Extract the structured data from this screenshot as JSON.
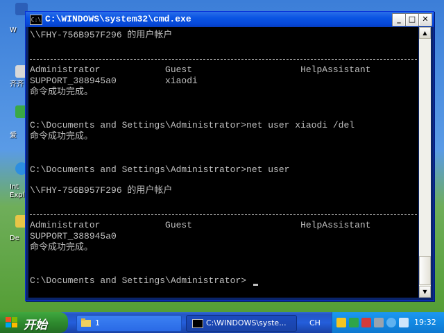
{
  "window": {
    "title": "C:\\WINDOWS\\system32\\cmd.exe",
    "minimize_label": "_",
    "maximize_label": "□",
    "close_label": "✕",
    "icon_label": "C:\\"
  },
  "console": {
    "lines": [
      "\\\\FHY-756B957F296 的用户帐户",
      "Administrator            Guest                    HelpAssistant",
      "SUPPORT_388945a0         xiaodi",
      "命令成功完成。",
      "C:\\Documents and Settings\\Administrator>net user xiaodi /del",
      "命令成功完成。",
      "C:\\Documents and Settings\\Administrator>net user",
      "\\\\FHY-756B957F296 的用户帐户",
      "Administrator            Guest                    HelpAssistant",
      "SUPPORT_388945a0",
      "命令成功完成。",
      "C:\\Documents and Settings\\Administrator>"
    ]
  },
  "desktop": {
    "labels": [
      "W",
      "齐齐",
      "爱",
      "Int",
      "Expl",
      "De"
    ]
  },
  "taskbar": {
    "start_label": "开始",
    "folder_task": "1",
    "cmd_task": "C:\\WINDOWS\\syste...",
    "language": "CH",
    "clock": "19:32"
  },
  "colors": {
    "console_bg": "#000000",
    "console_text": "#c0c0c0",
    "titlebar": "#0a54e3",
    "taskbar": "#245edb",
    "start_green": "#2e8a2e",
    "tray": "#1289e3"
  }
}
